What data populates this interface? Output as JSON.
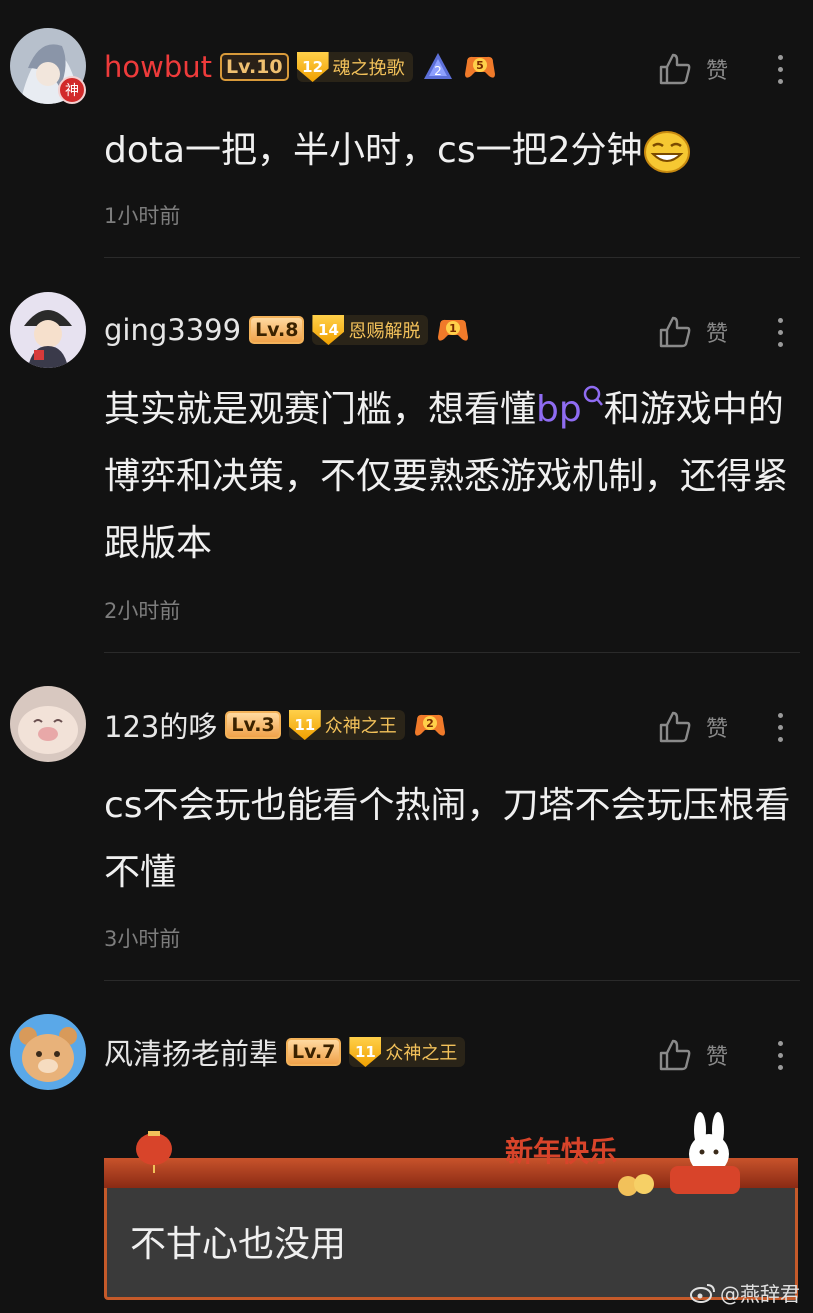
{
  "comments": [
    {
      "username": "howbut",
      "level": "Lv.10",
      "fan_badge_level": "12",
      "fan_badge_label": "魂之挽歌",
      "medal_number_a": "2",
      "medal_number_b": "5",
      "avatar_badge": "神",
      "text": "dota一把，半小时，cs一把2分钟",
      "time": "1小时前",
      "like_label": "赞"
    },
    {
      "username": "ging3399",
      "level": "Lv.8",
      "fan_badge_level": "14",
      "fan_badge_label": "恩赐解脱",
      "medal_number_a": "1",
      "text_before": "其实就是观赛门槛，想看懂",
      "text_link": "bp",
      "text_after": "和游戏中的博弈和决策，不仅要熟悉游戏机制，还得紧跟版本",
      "time": "2小时前",
      "like_label": "赞"
    },
    {
      "username": "123的哆",
      "level": "Lv.3",
      "fan_badge_level": "11",
      "fan_badge_label": "众神之王",
      "medal_number_a": "2",
      "text": "cs不会玩也能看个热闹，刀塔不会玩压根看不懂",
      "time": "3小时前",
      "like_label": "赞"
    },
    {
      "username": "风清扬老前辈",
      "level": "Lv.7",
      "fan_badge_level": "11",
      "fan_badge_label": "众神之王",
      "like_label": "赞",
      "reply_card_header": "新年快乐",
      "reply_card_text": "不甘心也没用"
    }
  ],
  "watermark": "@燕辞君",
  "colors": {
    "background": "#121212",
    "accent_purple": "#8f6cf2",
    "username_red": "#ee3b3b",
    "badge_gold": "#f2c15a"
  }
}
